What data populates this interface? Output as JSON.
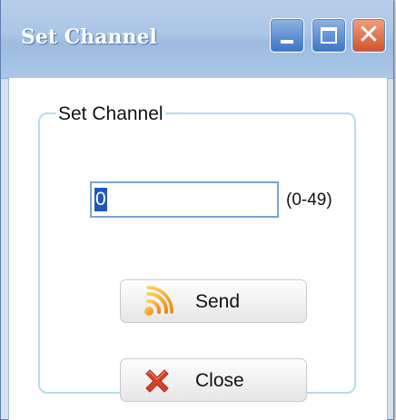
{
  "window": {
    "title": "Set Channel",
    "controls": [
      "minimize",
      "maximize",
      "close"
    ]
  },
  "group": {
    "legend": "Set Channel"
  },
  "channel": {
    "value": "0",
    "range_hint": "(0-49)"
  },
  "buttons": {
    "send": {
      "label": "Send",
      "icon": "signal-icon"
    },
    "close": {
      "label": "Close",
      "icon": "red-x-icon"
    }
  },
  "colors": {
    "title_bar": "#a9c5e6",
    "close_button": "#d4512a",
    "group_border": "#b6dcec",
    "selection": "#1f58b8"
  }
}
